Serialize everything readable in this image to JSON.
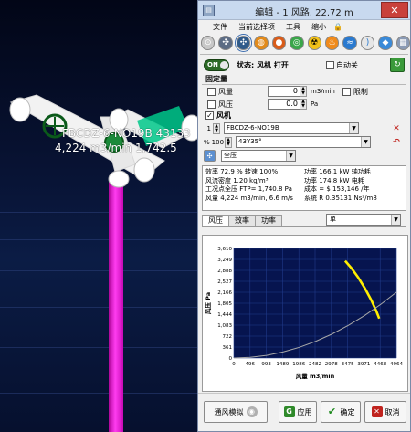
{
  "viewport": {
    "fan_label_1": "FBCDZ-6-NO19B 43133",
    "fan_label_2": "4,224 m3/min 1,742.5",
    "colors": {
      "shaft": "#ff3cf0",
      "pipe": "#ffffff",
      "fan_body": "#00a060"
    }
  },
  "window": {
    "title": "编辑 - 1 风路, 22.72 m",
    "icon": "app-icon",
    "close_icon": "close-icon"
  },
  "menu": {
    "items": [
      "文件",
      "当前选择项",
      "工具",
      "缩小"
    ],
    "lock_icon": "lock-icon"
  },
  "toolbar": {
    "icons": [
      "airway-icon",
      "fan-icon",
      "fan-selected-icon",
      "regulator-icon",
      "source-icon",
      "gas-icon",
      "radiation-icon",
      "fire-icon",
      "flow-icon",
      "wireless-icon",
      "layers-icon",
      "label-icon"
    ]
  },
  "status": {
    "switch_label": "ON",
    "text": "状态: 风机 打开",
    "auto_off_label": "自动关",
    "auto_off_checked": false
  },
  "fixed": {
    "section": "固定量",
    "flow_label": "风量",
    "flow_value": "0",
    "flow_unit": "m3/min",
    "limit_label": "限制",
    "pressure_label": "风压",
    "pressure_value": "0.0",
    "pressure_unit": "Pa"
  },
  "fan": {
    "section": "风机",
    "checked": true,
    "number": "1",
    "model": "FBCDZ-6-NO19B",
    "percent_label": "%",
    "percent": "100",
    "angle": "43Y35°",
    "mode": "全压",
    "info_left": [
      "效率 72.9 % 转速 100%",
      "风流密度 1.20 kg/m³",
      "工况点全压 FTP= 1,740.8 Pa",
      "风量 4,224 m3/min, 6.6 m/s"
    ],
    "info_right": [
      "功率 166.1 kW 轴功耗",
      "功率 174.8 kW 电耗",
      "成本 = $ 153,146 /年",
      "系统 R 0.35131 Ns²/m8"
    ]
  },
  "tabs": [
    "风压",
    "效率",
    "功率"
  ],
  "unit_select": "单",
  "chart_data": {
    "type": "line",
    "xlabel": "风量 m3/min",
    "ylabel": "风压 Pa",
    "xticks": [
      0,
      496,
      993,
      1489,
      1986,
      2482,
      2978,
      3475,
      3971,
      4468,
      4964
    ],
    "yticks": [
      0,
      361,
      722,
      1083,
      1444,
      1805,
      2166,
      2527,
      2888,
      3249,
      3610
    ],
    "xlim": [
      0,
      4964
    ],
    "ylim": [
      0,
      3610
    ],
    "grid": true,
    "series": [
      {
        "color": "#ffee00",
        "x": [
          3400,
          3600,
          3800,
          4000,
          4200,
          4350,
          4440
        ],
        "y": [
          3200,
          2950,
          2650,
          2300,
          1900,
          1550,
          1300
        ]
      },
      {
        "color": "#a8a8a8",
        "x": [
          0,
          500,
          1000,
          1500,
          2000,
          2500,
          3000,
          3500,
          4000,
          4500,
          4964
        ],
        "y": [
          0,
          22,
          88,
          198,
          351,
          549,
          790,
          1076,
          1405,
          1778,
          2166
        ]
      }
    ]
  },
  "footer": {
    "simulate_label": "通风模拟",
    "apply_label": "应用",
    "ok_label": "确定",
    "cancel_label": "取消"
  }
}
